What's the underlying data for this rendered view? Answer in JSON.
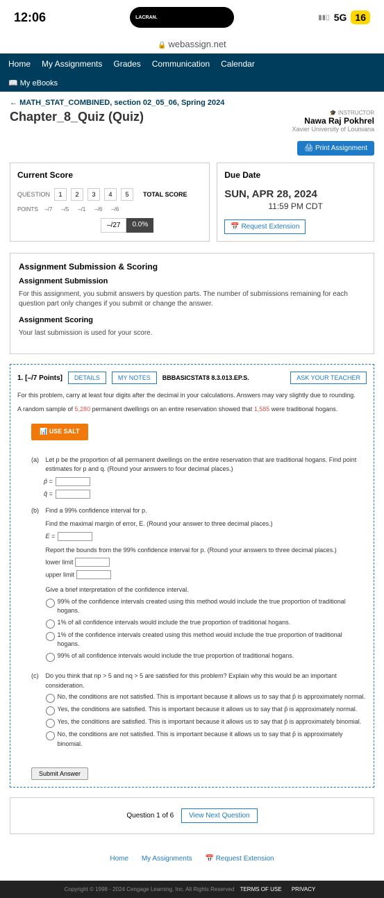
{
  "statusBar": {
    "time": "12:06",
    "pillText": "LACRAN.",
    "network": "5G",
    "battery": "16"
  },
  "url": "webassign.net",
  "nav": {
    "home": "Home",
    "assignments": "My Assignments",
    "grades": "Grades",
    "communication": "Communication",
    "calendar": "Calendar",
    "ebooks": "My eBooks"
  },
  "breadcrumb": "MATH_STAT_COMBINED, section 02_05_06, Spring 2024",
  "title": "Chapter_8_Quiz (Quiz)",
  "instructor": {
    "label": "INSTRUCTOR",
    "name": "Nawa Raj Pokhrel",
    "uni": "Xavier University of Louisiana"
  },
  "printBtn": "Print Assignment",
  "currentScore": {
    "title": "Current Score",
    "questionLabel": "QUESTION",
    "questions": [
      "1",
      "2",
      "3",
      "4",
      "5"
    ],
    "totalScoreLabel": "TOTAL SCORE",
    "pointsLabel": "POINTS",
    "points": [
      "–/7",
      "–/5",
      "–/1",
      "–/6",
      "–/6"
    ],
    "total": "–/27",
    "pct": "0.0%"
  },
  "dueDate": {
    "title": "Due Date",
    "date": "SUN, APR 28, 2024",
    "time": "11:59 PM CDT",
    "request": "Request Extension"
  },
  "submission": {
    "title": "Assignment Submission & Scoring",
    "sub1": "Assignment Submission",
    "text1": "For this assignment, you submit answers by question parts. The number of submissions remaining for each question part only changes if you submit or change the answer.",
    "sub2": "Assignment Scoring",
    "text2": "Your last submission is used for your score."
  },
  "question": {
    "num": "1. [–/7 Points]",
    "details": "DETAILS",
    "notes": "MY NOTES",
    "ref": "BBBASICSTAT8 8.3.013.EP.S.",
    "ask": "ASK YOUR TEACHER",
    "intro1": "For this problem, carry at least four digits after the decimal in your calculations. Answers may vary slightly due to rounding.",
    "intro2a": "A random sample of ",
    "intro2n1": "5,280",
    "intro2b": " permanent dwellings on an entire reservation showed that ",
    "intro2n2": "1,585",
    "intro2c": " were traditional hogans.",
    "useSalt": "USE SALT",
    "partA": {
      "text": "Let p be the proportion of all permanent dwellings on the entire reservation that are traditional hogans. Find point estimates for p and q. (Round your answers to four decimal places.)",
      "p": "p̂ =",
      "q": "q̂ ="
    },
    "partB": {
      "text1": "Find a 99% confidence interval for p.",
      "text2": "Find the maximal margin of error, E. (Round your answer to three decimal places.)",
      "e": "E =",
      "text3": "Report the bounds from the 99% confidence interval for p. (Round your answers to three decimal places.)",
      "lower": "lower limit",
      "upper": "upper limit",
      "text4": "Give a brief interpretation of the confidence interval.",
      "opt1": "99% of the confidence intervals created using this method would include the true proportion of traditional hogans.",
      "opt2": "1% of all confidence intervals would include the true proportion of traditional hogans.",
      "opt3": "1% of the confidence intervals created using this method would include the true proportion of traditional hogans.",
      "opt4": "99% of all confidence intervals would include the true proportion of traditional hogans."
    },
    "partC": {
      "text": "Do you think that np > 5 and nq > 5 are satisfied for this problem? Explain why this would be an important consideration.",
      "opt1": "No, the conditions are not satisfied. This is important because it allows us to say that p̂ is approximately normal.",
      "opt2": "Yes, the conditions are satisfied. This is important because it allows us to say that p̂ is approximately normal.",
      "opt3": "Yes, the conditions are satisfied. This is important because it allows us to say that p̂ is approximately binomial.",
      "opt4": "No, the conditions are not satisfied. This is important because it allows us to say that p̂ is approximately binomial."
    },
    "submit": "Submit Answer"
  },
  "pagination": {
    "text": "Question 1 of 6",
    "next": "View Next Question"
  },
  "footerLinks": {
    "home": "Home",
    "assignments": "My Assignments",
    "request": "Request Extension"
  },
  "copyright": {
    "text": "Copyright © 1998 - 2024 Cengage Learning, Inc. All Rights Reserved",
    "terms": "TERMS OF USE",
    "privacy": "PRIVACY"
  }
}
